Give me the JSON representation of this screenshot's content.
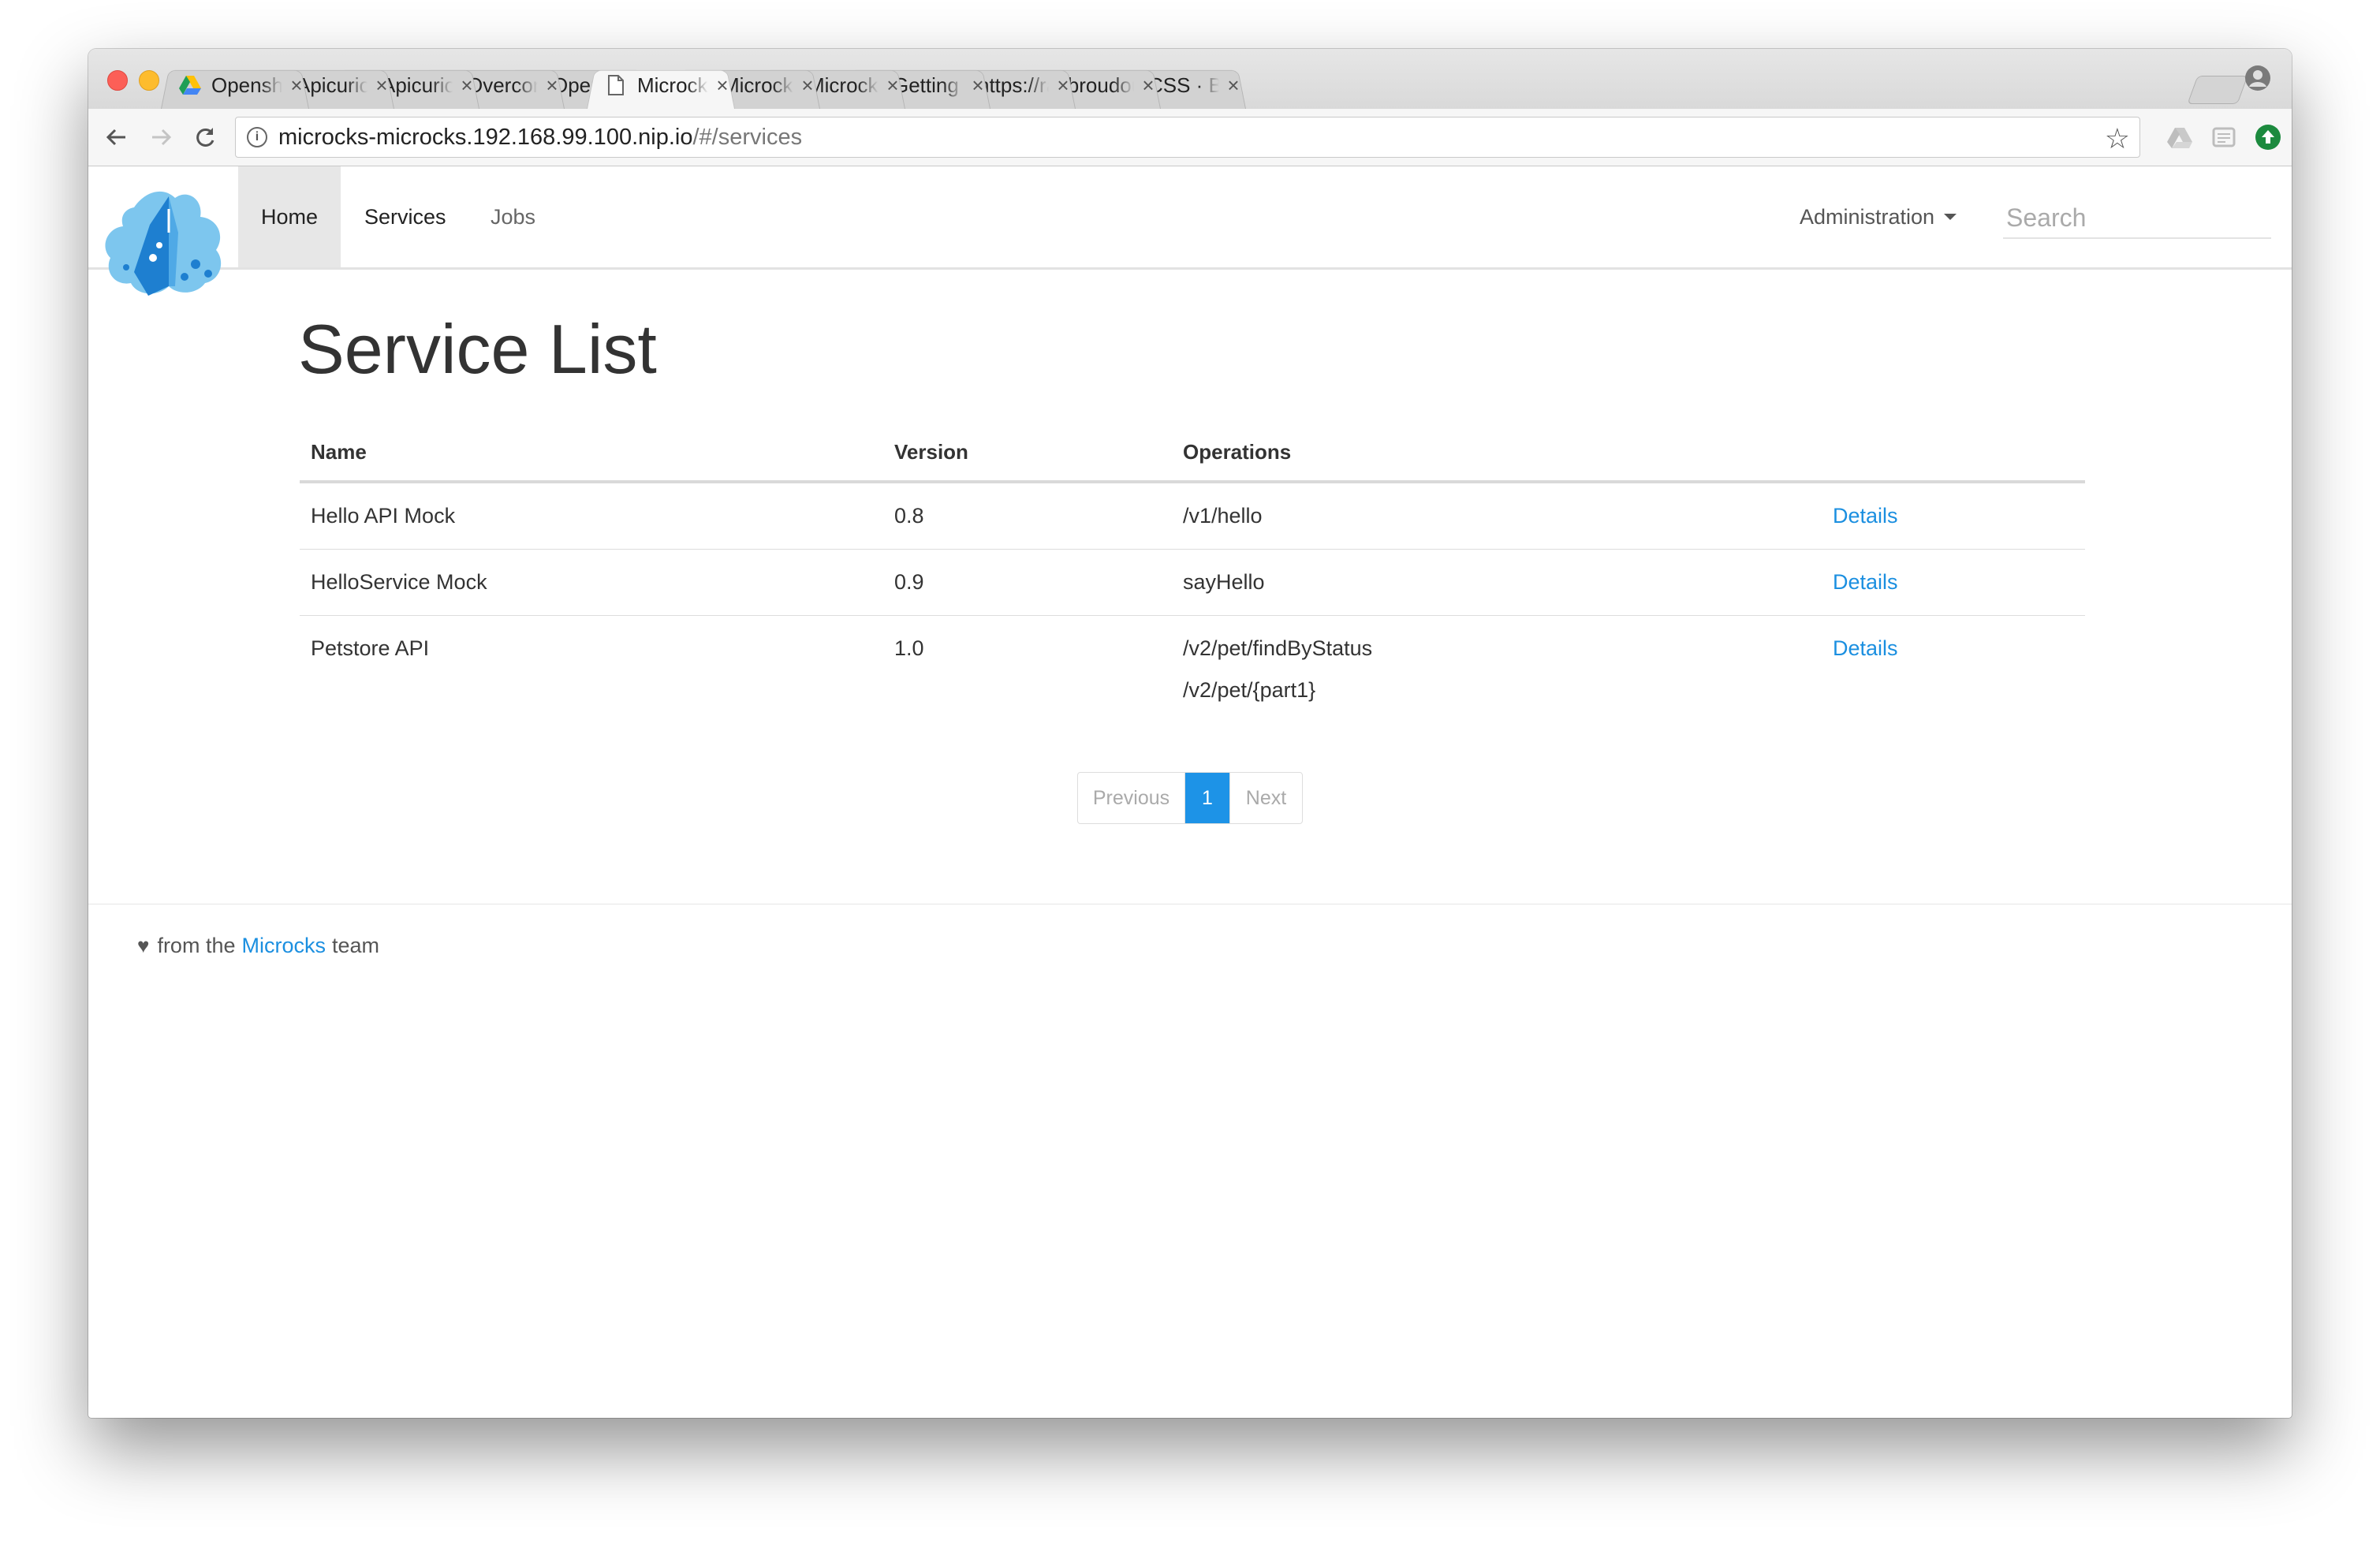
{
  "browser": {
    "tabs": [
      {
        "title": "Openshi",
        "icon": "google-drive-icon"
      },
      {
        "title": "Apicurio",
        "icon": "apicurio-icon"
      },
      {
        "title": "Apicurio",
        "icon": "apicurio-icon"
      },
      {
        "title": "Overcom",
        "icon": "openshift-icon"
      },
      {
        "title": "OpenShi",
        "icon": "openshift-icon"
      },
      {
        "title": "Microcks",
        "icon": "document-icon",
        "active": true
      },
      {
        "title": "Microcks",
        "icon": "microcks-hat-icon"
      },
      {
        "title": "Microcks",
        "icon": "microcks-hat-icon"
      },
      {
        "title": "Getting s",
        "icon": "document-icon"
      },
      {
        "title": "https://ra",
        "icon": "document-icon"
      },
      {
        "title": "lbroudou",
        "icon": "github-icon"
      },
      {
        "title": "CSS · Bo",
        "icon": "bootstrap-icon"
      }
    ],
    "close_glyph": "×",
    "url_host": "microcks-microcks.192.168.99.100.nip.io",
    "url_path": "/#/services"
  },
  "nav": {
    "home": "Home",
    "services": "Services",
    "jobs": "Jobs",
    "administration": "Administration",
    "search_placeholder": "Search"
  },
  "page": {
    "title": "Service List",
    "table": {
      "headers": [
        "Name",
        "Version",
        "Operations",
        ""
      ],
      "rows": [
        {
          "name": "Hello API Mock",
          "version": "0.8",
          "operations": [
            "/v1/hello"
          ],
          "action": "Details"
        },
        {
          "name": "HelloService Mock",
          "version": "0.9",
          "operations": [
            "sayHello"
          ],
          "action": "Details"
        },
        {
          "name": "Petstore API",
          "version": "1.0",
          "operations": [
            "/v2/pet/findByStatus",
            "/v2/pet/{part1}"
          ],
          "action": "Details"
        }
      ]
    },
    "pagination": {
      "previous": "Previous",
      "current": "1",
      "next": "Next"
    }
  },
  "footer": {
    "prefix": "from the",
    "link": "Microcks",
    "suffix": "team"
  },
  "colors": {
    "accent": "#1d93e7",
    "link": "#1b8fe0",
    "active_nav": "#e7e7e7"
  }
}
